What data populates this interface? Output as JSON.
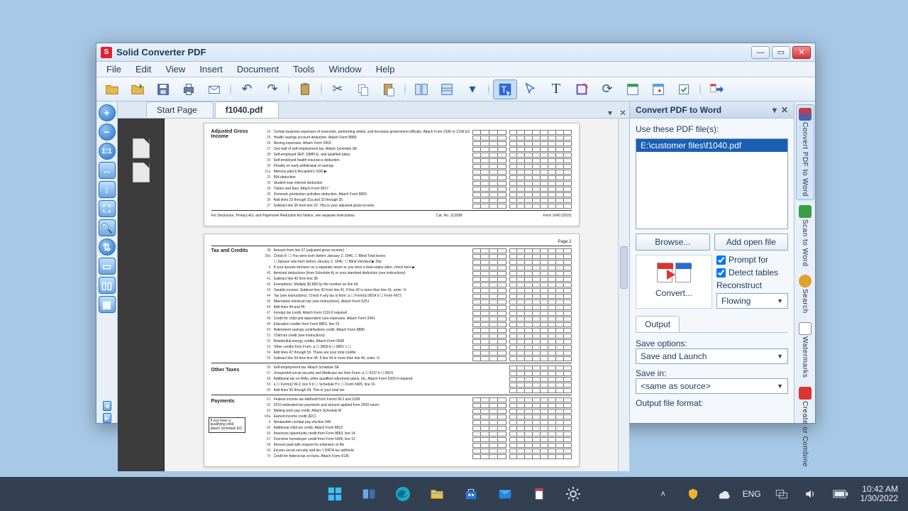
{
  "window": {
    "title": "Solid Converter PDF"
  },
  "menu": {
    "file": "File",
    "edit": "Edit",
    "view": "View",
    "insert": "Insert",
    "document": "Document",
    "tools": "Tools",
    "window": "Window",
    "help": "Help"
  },
  "tabs": {
    "start": "Start Page",
    "doc": "f1040.pdf"
  },
  "panel": {
    "title": "Convert PDF to Word",
    "use_files": "Use these PDF file(s):",
    "file_selected": "E:\\customer files\\f1040.pdf",
    "browse": "Browse...",
    "add_open": "Add open file",
    "convert": "Convert...",
    "opt_prompt": "Prompt for",
    "opt_detect": "Detect tables",
    "reconstruct": "Reconstruct",
    "flowing": "Flowing",
    "output_tab": "Output",
    "save_options": "Save options:",
    "save_launch": "Save and Launch",
    "save_in": "Save in:",
    "same_source": "<same as source>",
    "output_format": "Output file format:"
  },
  "sidebar": {
    "convert": "Convert PDF to Word",
    "scan": "Scan to Word",
    "search": "Search",
    "watermarks": "Watermarks",
    "create": "Create or Combine"
  },
  "document": {
    "page1": {
      "section1": "Adjusted\nGross\nIncome",
      "lines": [
        {
          "n": "24",
          "t": "Certain business expenses of reservists, performing artists, and fee-basis government officials. Attach Form 2106 or 2106-EZ"
        },
        {
          "n": "25",
          "t": "Health savings account deduction. Attach Form 8889"
        },
        {
          "n": "26",
          "t": "Moving expenses. Attach Form 3903"
        },
        {
          "n": "27",
          "t": "One-half of self-employment tax. Attach Schedule SE"
        },
        {
          "n": "28",
          "t": "Self-employed SEP, SIMPLE, and qualified plans"
        },
        {
          "n": "29",
          "t": "Self-employed health insurance deduction"
        },
        {
          "n": "30",
          "t": "Penalty on early withdrawal of savings"
        },
        {
          "n": "31a",
          "t": "Alimony paid   b Recipient's SSN ▶"
        },
        {
          "n": "32",
          "t": "IRA deduction"
        },
        {
          "n": "33",
          "t": "Student loan interest deduction"
        },
        {
          "n": "34",
          "t": "Tuition and fees. Attach Form 8917"
        },
        {
          "n": "35",
          "t": "Domestic production activities deduction. Attach Form 8903"
        },
        {
          "n": "36",
          "t": "Add lines 23 through 31a and 32 through 35"
        },
        {
          "n": "37",
          "t": "Subtract line 36 from line 22. This is your adjusted gross income"
        }
      ],
      "footer_l": "For Disclosure, Privacy Act, and Paperwork Reduction Act Notice, see separate instructions.",
      "footer_c": "Cat. No. 11320B",
      "footer_r": "Form 1040 (2010)"
    },
    "page2": {
      "header_r": "Page 2",
      "section1": "Tax and\nCredits",
      "section2": "Other\nTaxes",
      "section3": "Payments",
      "sidebox": "If you have a qualifying child, attach Schedule EIC",
      "lines1": [
        {
          "n": "38",
          "t": "Amount from line 37 (adjusted gross income)"
        },
        {
          "n": "39a",
          "t": "Check if: ☐ You were born before January 2, 1946, ☐ Blind  Total boxes"
        },
        {
          "n": "",
          "t": "           ☐ Spouse was born before January 2, 1946, ☐ Blind  checked ▶ 39a"
        },
        {
          "n": "b",
          "t": "If your spouse itemizes on a separate return or you were a dual-status alien, check here ▶"
        },
        {
          "n": "40",
          "t": "Itemized deductions (from Schedule A) or your standard deduction (see instructions)"
        },
        {
          "n": "41",
          "t": "Subtract line 40 from line 38"
        },
        {
          "n": "42",
          "t": "Exemptions. Multiply $3,650 by the number on line 6d"
        },
        {
          "n": "43",
          "t": "Taxable income. Subtract line 42 from line 41. If line 42 is more than line 41, enter -0-"
        },
        {
          "n": "44",
          "t": "Tax (see instructions). Check if any tax is from: a ☐ Form(s) 8814  b ☐ Form 4972"
        },
        {
          "n": "45",
          "t": "Alternative minimum tax (see instructions). Attach Form 6251"
        },
        {
          "n": "46",
          "t": "Add lines 44 and 45"
        },
        {
          "n": "47",
          "t": "Foreign tax credit. Attach Form 1116 if required"
        },
        {
          "n": "48",
          "t": "Credit for child and dependent care expenses. Attach Form 2441"
        },
        {
          "n": "49",
          "t": "Education credits from Form 8863, line 23"
        },
        {
          "n": "50",
          "t": "Retirement savings contributions credit. Attach Form 8880"
        },
        {
          "n": "51",
          "t": "Child tax credit (see instructions)"
        },
        {
          "n": "52",
          "t": "Residential energy credits. Attach Form 5695"
        },
        {
          "n": "53",
          "t": "Other credits from Form: a ☐ 3800 b ☐ 8801 c ☐"
        },
        {
          "n": "54",
          "t": "Add lines 47 through 53. These are your total credits"
        },
        {
          "n": "55",
          "t": "Subtract line 54 from line 46. If line 54 is more than line 46, enter -0-"
        }
      ],
      "lines2": [
        {
          "n": "56",
          "t": "Self-employment tax. Attach Schedule SE"
        },
        {
          "n": "57",
          "t": "Unreported social security and Medicare tax from Form: a ☐ 4137  b ☐ 8919"
        },
        {
          "n": "58",
          "t": "Additional tax on IRAs, other qualified retirement plans, etc. Attach Form 5329 if required"
        },
        {
          "n": "59",
          "t": "a ☐ Form(s) W-2, box 9  b ☐ Schedule H  c ☐ Form 5405, line 16"
        },
        {
          "n": "60",
          "t": "Add lines 55 through 59. This is your total tax"
        }
      ],
      "lines3": [
        {
          "n": "61",
          "t": "Federal income tax withheld from Forms W-2 and 1099"
        },
        {
          "n": "62",
          "t": "2010 estimated tax payments and amount applied from 2009 return"
        },
        {
          "n": "63",
          "t": "Making work pay credit. Attach Schedule M"
        },
        {
          "n": "64a",
          "t": "Earned income credit (EIC)"
        },
        {
          "n": "b",
          "t": "Nontaxable combat pay election  64b"
        },
        {
          "n": "65",
          "t": "Additional child tax credit. Attach Form 8812"
        },
        {
          "n": "66",
          "t": "American opportunity credit from Form 8863, line 14"
        },
        {
          "n": "67",
          "t": "First-time homebuyer credit from Form 5405, line 10"
        },
        {
          "n": "68",
          "t": "Amount paid with request for extension to file"
        },
        {
          "n": "69",
          "t": "Excess social security and tier 1 RRTA tax withheld"
        },
        {
          "n": "70",
          "t": "Credit for federal tax on fuels. Attach Form 4136"
        }
      ]
    }
  },
  "taskbar": {
    "lang": "ENG",
    "time": "10:42 AM",
    "date": "1/30/2022"
  }
}
